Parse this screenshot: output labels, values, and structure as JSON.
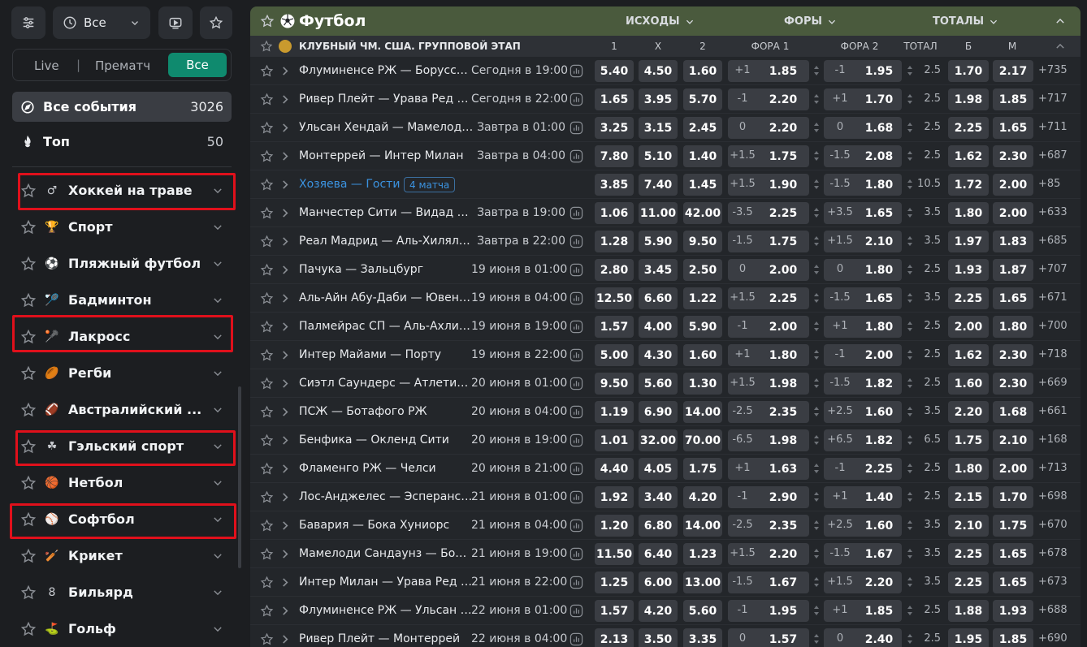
{
  "sidebar": {
    "top_all_label": "Все",
    "filter": {
      "live": "Live",
      "separator": "|",
      "prematch": "Прематч",
      "all": "Все"
    },
    "all_events": {
      "label": "Все события",
      "count": "3026"
    },
    "top": {
      "label": "Топ",
      "count": "50"
    },
    "sports": [
      {
        "label": "Хоккей на траве",
        "icon": "field-hockey-icon",
        "glyph": "♂"
      },
      {
        "label": "Спорт",
        "icon": "trophy-icon",
        "glyph": "🏆"
      },
      {
        "label": "Пляжный футбол",
        "icon": "beach-soccer-icon",
        "glyph": "⚽"
      },
      {
        "label": "Бадминтон",
        "icon": "badminton-icon",
        "glyph": "🏸"
      },
      {
        "label": "Лакросс",
        "icon": "lacrosse-icon",
        "glyph": "🥍"
      },
      {
        "label": "Регби",
        "icon": "rugby-icon",
        "glyph": "🏉"
      },
      {
        "label": "Австралийский ...",
        "icon": "aussie-rules-icon",
        "glyph": "🏈"
      },
      {
        "label": "Гэльский спорт",
        "icon": "gaelic-sport-icon",
        "glyph": "☘"
      },
      {
        "label": "Нетбол",
        "icon": "netball-icon",
        "glyph": "🏀"
      },
      {
        "label": "Софтбол",
        "icon": "softball-icon",
        "glyph": "⚾"
      },
      {
        "label": "Крикет",
        "icon": "cricket-icon",
        "glyph": "🏏"
      },
      {
        "label": "Бильярд",
        "icon": "billiards-icon",
        "glyph": "8"
      },
      {
        "label": "Гольф",
        "icon": "golf-icon",
        "glyph": "⛳"
      }
    ]
  },
  "main": {
    "title": "Футбол",
    "groups": {
      "outcomes": "ИСХОДЫ",
      "handicaps": "ФОРЫ",
      "totals": "ТОТАЛЫ"
    },
    "league": "КЛУБНЫЙ ЧМ. США. ГРУППОВОЙ ЭТАП",
    "columns": {
      "c1": "1",
      "cx": "X",
      "c2": "2",
      "h1": "ФОРА 1",
      "h2": "ФОРА 2",
      "total": "ТОТАЛ",
      "over": "Б",
      "under": "М"
    },
    "matches": [
      {
        "teams": "Флуминенсе РЖ — Боруссия Дортмунд",
        "time": "Сегодня в 19:00",
        "o1": "5.40",
        "ox": "4.50",
        "o2": "1.60",
        "h1": "+1",
        "h1o": "1.85",
        "h2": "-1",
        "h2o": "1.95",
        "t": "2.5",
        "tb": "1.70",
        "tm": "2.17",
        "more": "+735"
      },
      {
        "teams": "Ривер Плейт — Урава Ред Даймондс",
        "time": "Сегодня в 22:00",
        "o1": "1.65",
        "ox": "3.95",
        "o2": "5.70",
        "h1": "-1",
        "h1o": "2.20",
        "h2": "+1",
        "h2o": "1.70",
        "t": "2.5",
        "tb": "1.98",
        "tm": "1.85",
        "more": "+717"
      },
      {
        "teams": "Ульсан Хендай — Мамелоди Сандаунз",
        "time": "Завтра в 01:00",
        "o1": "3.25",
        "ox": "3.15",
        "o2": "2.45",
        "h1": "0",
        "h1o": "2.20",
        "h2": "0",
        "h2o": "1.68",
        "t": "2.5",
        "tb": "2.25",
        "tm": "1.65",
        "more": "+711"
      },
      {
        "teams": "Монтеррей — Интер Милан",
        "time": "Завтра в 04:00",
        "o1": "7.80",
        "ox": "5.10",
        "o2": "1.40",
        "h1": "+1.5",
        "h1o": "1.75",
        "h2": "-1.5",
        "h2o": "2.08",
        "t": "2.5",
        "tb": "1.62",
        "tm": "2.30",
        "more": "+687"
      },
      {
        "teams": "Хозяева — Гости",
        "special": true,
        "badge": "4 матча",
        "time": "",
        "o1": "3.85",
        "ox": "7.40",
        "o2": "1.45",
        "h1": "+1.5",
        "h1o": "1.90",
        "h2": "-1.5",
        "h2o": "1.80",
        "t": "10.5",
        "tb": "1.72",
        "tm": "2.00",
        "more": "+85"
      },
      {
        "teams": "Манчестер Сити — Видад Касабланка",
        "time": "Завтра в 19:00",
        "o1": "1.06",
        "ox": "11.00",
        "o2": "42.00",
        "h1": "-3.5",
        "h1o": "2.25",
        "h2": "+3.5",
        "h2o": "1.65",
        "t": "3.5",
        "tb": "1.80",
        "tm": "2.00",
        "more": "+633"
      },
      {
        "teams": "Реал Мадрид — Аль-Хиляль Эр-Рияд",
        "time": "Завтра в 22:00",
        "o1": "1.28",
        "ox": "5.90",
        "o2": "9.50",
        "h1": "-1.5",
        "h1o": "1.75",
        "h2": "+1.5",
        "h2o": "2.10",
        "t": "3.5",
        "tb": "1.97",
        "tm": "1.83",
        "more": "+685"
      },
      {
        "teams": "Пачука — Зальцбург",
        "time": "19 июня в 01:00",
        "o1": "2.80",
        "ox": "3.45",
        "o2": "2.50",
        "h1": "0",
        "h1o": "2.00",
        "h2": "0",
        "h2o": "1.80",
        "t": "2.5",
        "tb": "1.93",
        "tm": "1.87",
        "more": "+707"
      },
      {
        "teams": "Аль-Айн Абу-Даби — Ювентус",
        "time": "19 июня в 04:00",
        "o1": "12.50",
        "ox": "6.60",
        "o2": "1.22",
        "h1": "+1.5",
        "h1o": "2.25",
        "h2": "-1.5",
        "h2o": "1.65",
        "t": "3.5",
        "tb": "2.25",
        "tm": "1.65",
        "more": "+671"
      },
      {
        "teams": "Палмейрас СП — Аль-Ахли Каир",
        "time": "19 июня в 19:00",
        "o1": "1.57",
        "ox": "4.00",
        "o2": "5.90",
        "h1": "-1",
        "h1o": "2.00",
        "h2": "+1",
        "h2o": "1.80",
        "t": "2.5",
        "tb": "2.00",
        "tm": "1.80",
        "more": "+700"
      },
      {
        "teams": "Интер Майами — Порту",
        "time": "19 июня в 22:00",
        "o1": "5.00",
        "ox": "4.30",
        "o2": "1.60",
        "h1": "+1",
        "h1o": "1.80",
        "h2": "-1",
        "h2o": "2.00",
        "t": "2.5",
        "tb": "1.62",
        "tm": "2.30",
        "more": "+718"
      },
      {
        "teams": "Сиэтл Саундерс — Атлетико Мадрид",
        "time": "20 июня в 01:00",
        "o1": "9.50",
        "ox": "5.60",
        "o2": "1.30",
        "h1": "+1.5",
        "h1o": "1.98",
        "h2": "-1.5",
        "h2o": "1.82",
        "t": "2.5",
        "tb": "1.60",
        "tm": "2.30",
        "more": "+669"
      },
      {
        "teams": "ПСЖ — Ботафого РЖ",
        "time": "20 июня в 04:00",
        "o1": "1.19",
        "ox": "6.90",
        "o2": "14.00",
        "h1": "-2.5",
        "h1o": "2.35",
        "h2": "+2.5",
        "h2o": "1.60",
        "t": "3.5",
        "tb": "2.20",
        "tm": "1.68",
        "more": "+661"
      },
      {
        "teams": "Бенфика — Окленд Сити",
        "time": "20 июня в 19:00",
        "o1": "1.01",
        "ox": "32.00",
        "o2": "70.00",
        "h1": "-6.5",
        "h1o": "1.98",
        "h2": "+6.5",
        "h2o": "1.82",
        "t": "6.5",
        "tb": "1.75",
        "tm": "2.10",
        "more": "+168"
      },
      {
        "teams": "Фламенго РЖ — Челси",
        "time": "20 июня в 21:00",
        "o1": "4.40",
        "ox": "4.05",
        "o2": "1.75",
        "h1": "+1",
        "h1o": "1.63",
        "h2": "-1",
        "h2o": "2.25",
        "t": "2.5",
        "tb": "1.80",
        "tm": "2.00",
        "more": "+713"
      },
      {
        "teams": "Лос-Анджелес — Эсперанс Тунис",
        "time": "21 июня в 01:00",
        "o1": "1.92",
        "ox": "3.40",
        "o2": "4.20",
        "h1": "-1",
        "h1o": "2.90",
        "h2": "+1",
        "h2o": "1.40",
        "t": "2.5",
        "tb": "2.15",
        "tm": "1.70",
        "more": "+698"
      },
      {
        "teams": "Бавария — Бока Хуниорс",
        "time": "21 июня в 04:00",
        "o1": "1.20",
        "ox": "6.80",
        "o2": "14.00",
        "h1": "-2.5",
        "h1o": "2.35",
        "h2": "+2.5",
        "h2o": "1.60",
        "t": "3.5",
        "tb": "2.10",
        "tm": "1.75",
        "more": "+670"
      },
      {
        "teams": "Мамелоди Сандаунз — Боруссия Дортмунд",
        "time": "21 июня в 19:00",
        "o1": "11.50",
        "ox": "6.40",
        "o2": "1.23",
        "h1": "+1.5",
        "h1o": "2.20",
        "h2": "-1.5",
        "h2o": "1.67",
        "t": "3.5",
        "tb": "2.25",
        "tm": "1.65",
        "more": "+678"
      },
      {
        "teams": "Интер Милан — Урава Ред Даймондс",
        "time": "21 июня в 22:00",
        "o1": "1.25",
        "ox": "6.00",
        "o2": "13.00",
        "h1": "-1.5",
        "h1o": "1.67",
        "h2": "+1.5",
        "h2o": "2.20",
        "t": "3.5",
        "tb": "2.25",
        "tm": "1.65",
        "more": "+673"
      },
      {
        "teams": "Флуминенсе РЖ — Ульсан Хендай",
        "time": "22 июня в 01:00",
        "o1": "1.57",
        "ox": "4.20",
        "o2": "5.60",
        "h1": "-1",
        "h1o": "1.95",
        "h2": "+1",
        "h2o": "1.85",
        "t": "2.5",
        "tb": "1.88",
        "tm": "1.93",
        "more": "+688"
      },
      {
        "teams": "Ривер Плейт — Монтеррей",
        "time": "22 июня в 04:00",
        "o1": "2.13",
        "ox": "3.50",
        "o2": "3.35",
        "h1": "0",
        "h1o": "1.57",
        "h2": "0",
        "h2o": "2.40",
        "t": "2.5",
        "tb": "1.95",
        "tm": "1.85",
        "more": "+690"
      }
    ]
  }
}
